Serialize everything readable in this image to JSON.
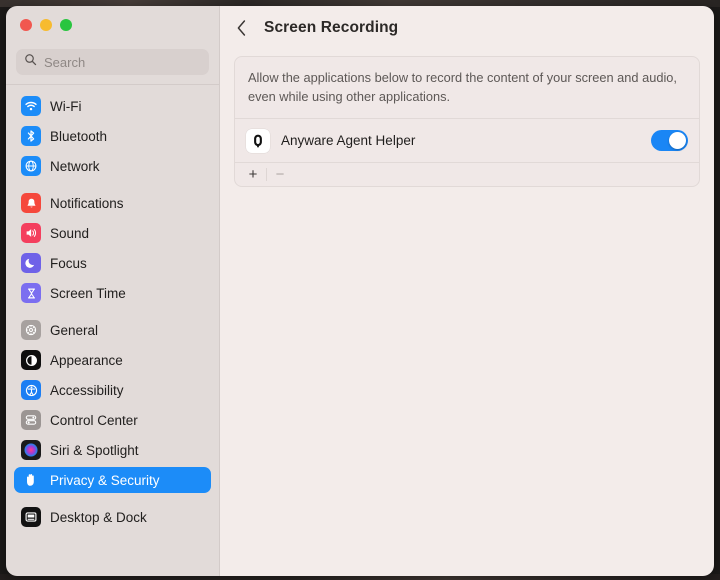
{
  "window": {
    "traffic_lights": [
      "close",
      "minimize",
      "zoom"
    ]
  },
  "sidebar": {
    "search": {
      "placeholder": "Search",
      "value": ""
    },
    "groups": [
      {
        "items": [
          {
            "label": "Wi-Fi",
            "icon": "wifi-icon",
            "selected": false
          },
          {
            "label": "Bluetooth",
            "icon": "bluetooth-icon",
            "selected": false
          },
          {
            "label": "Network",
            "icon": "network-icon",
            "selected": false
          }
        ]
      },
      {
        "items": [
          {
            "label": "Notifications",
            "icon": "notifications-icon",
            "selected": false
          },
          {
            "label": "Sound",
            "icon": "sound-icon",
            "selected": false
          },
          {
            "label": "Focus",
            "icon": "focus-icon",
            "selected": false
          },
          {
            "label": "Screen Time",
            "icon": "screen-time-icon",
            "selected": false
          }
        ]
      },
      {
        "items": [
          {
            "label": "General",
            "icon": "general-icon",
            "selected": false
          },
          {
            "label": "Appearance",
            "icon": "appearance-icon",
            "selected": false
          },
          {
            "label": "Accessibility",
            "icon": "accessibility-icon",
            "selected": false
          },
          {
            "label": "Control Center",
            "icon": "control-center-icon",
            "selected": false
          },
          {
            "label": "Siri & Spotlight",
            "icon": "siri-icon",
            "selected": false
          },
          {
            "label": "Privacy & Security",
            "icon": "privacy-hand-icon",
            "selected": true
          }
        ]
      },
      {
        "items": [
          {
            "label": "Desktop & Dock",
            "icon": "desktop-dock-icon",
            "selected": false
          }
        ]
      }
    ]
  },
  "main": {
    "back_label": "",
    "title": "Screen Recording",
    "description": "Allow the applications below to record the content of your screen and audio, even while using other applications.",
    "apps": [
      {
        "name": "Anyware Agent Helper",
        "icon": "anyware-app-icon",
        "enabled": true,
        "toggle_state": "on"
      }
    ],
    "footer": {
      "add_label": "+",
      "remove_label": "−"
    }
  },
  "colors": {
    "accent_blue": "#1c8cf8",
    "toggle_on": "#1a86f5",
    "sidebar_bg": "#e2dbd9",
    "content_bg": "#f3ecea",
    "card_bg": "#f0e8e7"
  }
}
